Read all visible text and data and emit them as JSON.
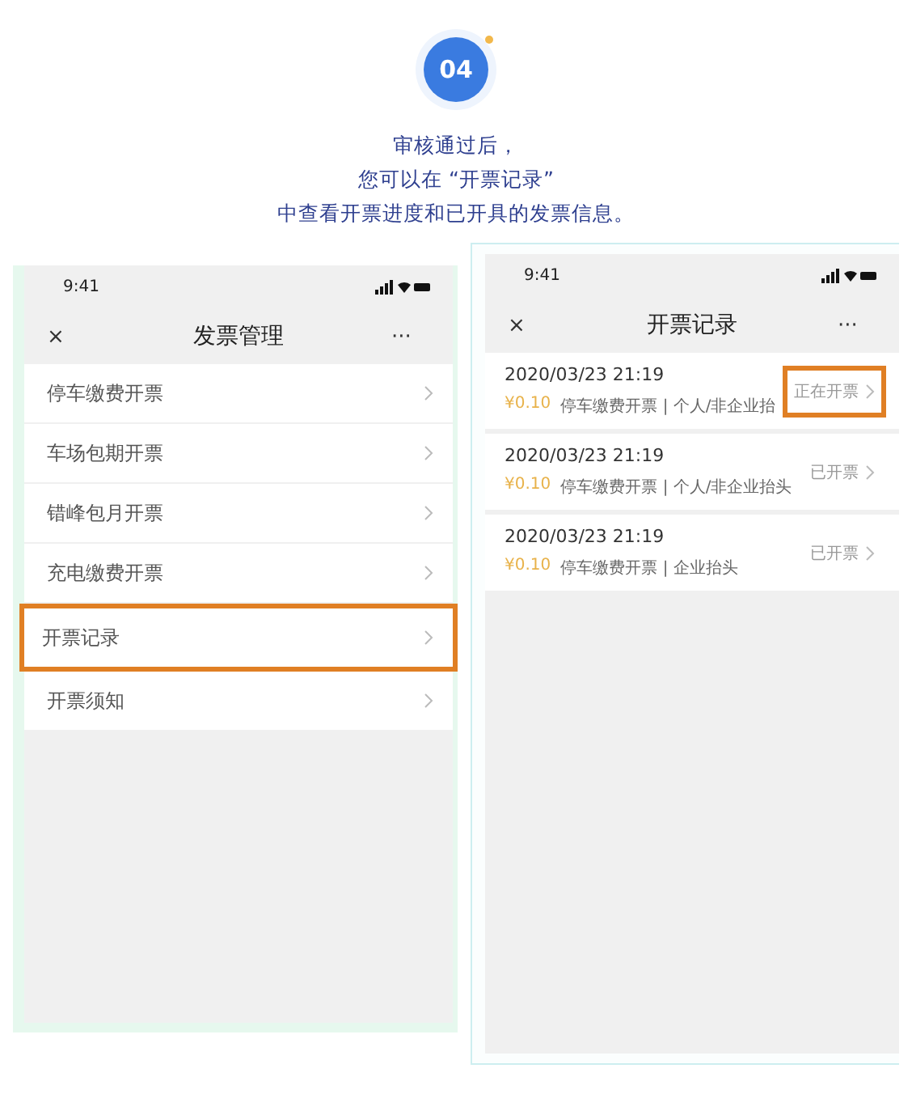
{
  "step": {
    "number": "04",
    "lines": [
      "审核通过后，",
      "您可以在 “开票记录”",
      "中查看开票进度和已开具的发票信息。"
    ]
  },
  "left_phone": {
    "status_bar": {
      "time": "9:41"
    },
    "nav": {
      "close": "×",
      "title": "发票管理",
      "more": "···"
    },
    "items": [
      {
        "label": "停车缴费开票",
        "highlighted": false
      },
      {
        "label": "车场包期开票",
        "highlighted": false
      },
      {
        "label": "错峰包月开票",
        "highlighted": false
      },
      {
        "label": "充电缴费开票",
        "highlighted": false
      },
      {
        "label": "开票记录",
        "highlighted": true
      },
      {
        "label": "开票须知",
        "highlighted": false
      }
    ]
  },
  "right_phone": {
    "status_bar": {
      "time": "9:41"
    },
    "nav": {
      "close": "×",
      "title": "开票记录",
      "more": "···"
    },
    "records": [
      {
        "datetime": "2020/03/23 21:19",
        "amount": "¥0.10",
        "detail": "停车缴费开票 | 个人/非企业抬",
        "status": "正在开票",
        "highlighted": true
      },
      {
        "datetime": "2020/03/23 21:19",
        "amount": "¥0.10",
        "detail": "停车缴费开票 | 个人/非企业抬头",
        "status": "已开票",
        "highlighted": false
      },
      {
        "datetime": "2020/03/23 21:19",
        "amount": "¥0.10",
        "detail": "停车缴费开票 | 企业抬头",
        "status": "已开票",
        "highlighted": false
      }
    ]
  }
}
